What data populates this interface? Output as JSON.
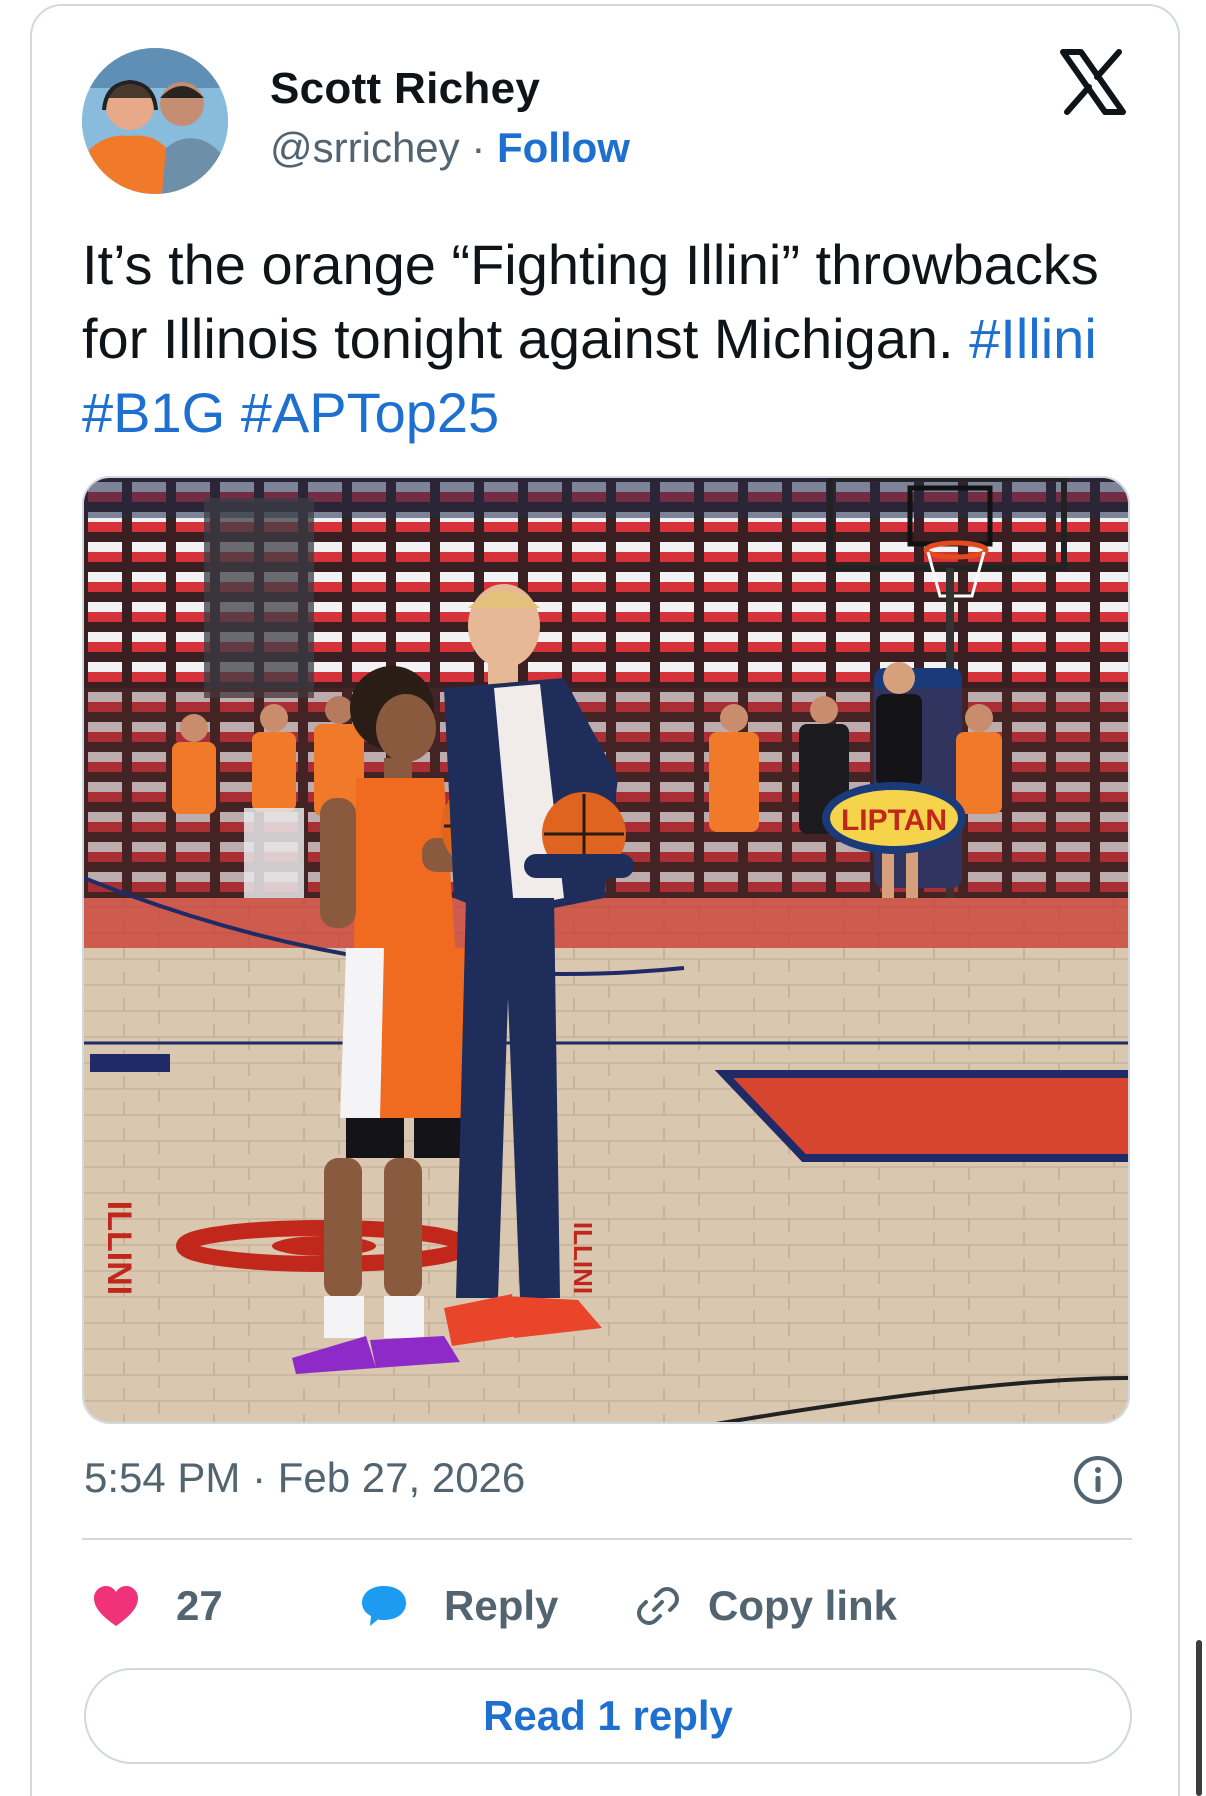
{
  "author": {
    "name": "Scott Richey",
    "handle": "@srrichey",
    "separator": "·",
    "follow_label": "Follow"
  },
  "tweet": {
    "text": "It’s the orange “Fighting Illini” throwbacks for Illinois tonight against Michigan.",
    "hashtags": [
      "#Illini",
      "#B1G",
      "#APTop25"
    ]
  },
  "media": {
    "court_text": [
      "ILLINI",
      "ILLINI"
    ],
    "banner_text": "LIPTAN"
  },
  "timestamp": "5:54 PM · Feb 27, 2026",
  "actions": {
    "like_count": "27",
    "reply_label": "Reply",
    "copy_link_label": "Copy link"
  },
  "read_reply_label": "Read 1 reply",
  "colors": {
    "link": "#1d6fd0",
    "heart": "#f0327a",
    "reply_bubble": "#1d9bf0",
    "secondary_text": "#536471",
    "border": "#cfd9de"
  },
  "icons": {
    "logo": "x-logo-icon",
    "info": "info-icon",
    "like": "heart-icon",
    "reply": "speech-bubble-icon",
    "copy": "link-icon"
  }
}
